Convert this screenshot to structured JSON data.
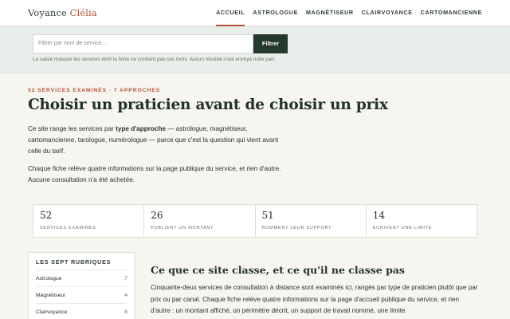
{
  "header": {
    "logo_main": "Voyance",
    "logo_accent": "Clélia",
    "nav": [
      {
        "label": "ACCUEIL"
      },
      {
        "label": "ASTROLOGUE"
      },
      {
        "label": "MAGNÉTISEUR"
      },
      {
        "label": "CLAIRVOYANCE"
      },
      {
        "label": "CARTOMANCIENNE"
      }
    ]
  },
  "filter": {
    "placeholder": "Filtrer par nom de service…",
    "button_label": "Filtrer",
    "note": "La saisie masque les services dont la fiche ne contient pas ces mots. Aucun résultat n'est envoyé nulle part."
  },
  "hero": {
    "eyebrow": "52 SERVICES EXAMINÉS · 7 APPROCHES",
    "title": "Choisir un praticien avant de choisir un prix",
    "intro_before": "Ce site range les services par ",
    "intro_strong": "type d'approche",
    "intro_after": " — astrologue, magnétiseur, cartomancienne, tarologue, numérologue — parce que c'est la question qui vient avant celle du tarif.",
    "intro2": "Chaque fiche relève quatre informations sur la page publique du service, et rien d'autre. Aucune consultation n'a été achetée."
  },
  "stats": [
    {
      "value": "52",
      "label": "SERVICES EXAMINÉS"
    },
    {
      "value": "26",
      "label": "PUBLIENT UN MONTANT"
    },
    {
      "value": "51",
      "label": "NOMMENT LEUR SUPPORT"
    },
    {
      "value": "14",
      "label": "ÉCRIVENT UNE LIMITE"
    }
  ],
  "sidebar": {
    "title": "LES SEPT RUBRIQUES",
    "items": [
      {
        "label": "Astrologue",
        "count": "7"
      },
      {
        "label": "Magnétiseur",
        "count": "4"
      },
      {
        "label": "Clairvoyance",
        "count": "8"
      }
    ]
  },
  "section": {
    "title": "Ce que ce site classe, et ce qu'il ne classe pas",
    "body": "Cinquante-deux services de consultation à distance sont examinés ici, rangés par type de praticien plutôt que par prix ou par canal. Chaque fiche relève quatre informations sur la page d'accueil publique du service, et rien d'autre : un montant affiché, un périmètre décrit, un support de travail nommé, une limite"
  },
  "colors": {
    "accent": "#b4533a",
    "dark_green": "#24392e",
    "band": "#e8eee9"
  }
}
